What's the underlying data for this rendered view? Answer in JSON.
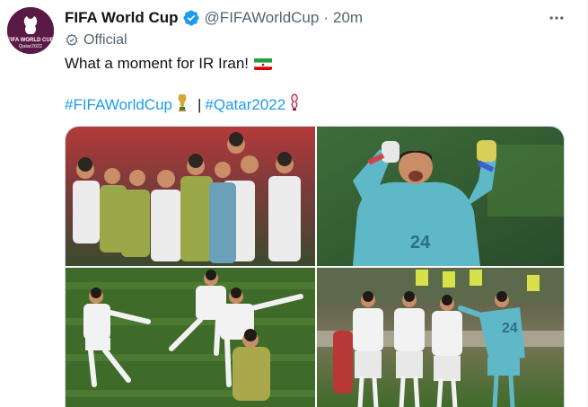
{
  "tweet": {
    "display_name": "FIFA World Cup",
    "handle": "@FIFAWorldCup",
    "separator": "·",
    "time": "20m",
    "official_label": "Official",
    "text": "What a moment for IR Iran!",
    "hashtag_1": "#FIFAWorldCup",
    "pipe": "|",
    "hashtag_2": "#Qatar2022"
  },
  "avatar": {
    "logo_text": "FIFA WORLD CUP",
    "sub_text": "Qatar2022"
  },
  "icons": {
    "verified": "verified-badge-icon",
    "official": "official-check-icon",
    "more": "more-dots-icon",
    "flag": "iran-flag-icon",
    "trophy": "trophy-icon",
    "qatar": "qatar-emblem-icon"
  },
  "colors": {
    "link": "#1d9bf0",
    "secondary": "#536471",
    "avatar_bg": "#5b1a45",
    "pitch": "#3f6b2a",
    "keeper_kit": "#5fb8c8",
    "team_kit": "#f2f2f2"
  }
}
